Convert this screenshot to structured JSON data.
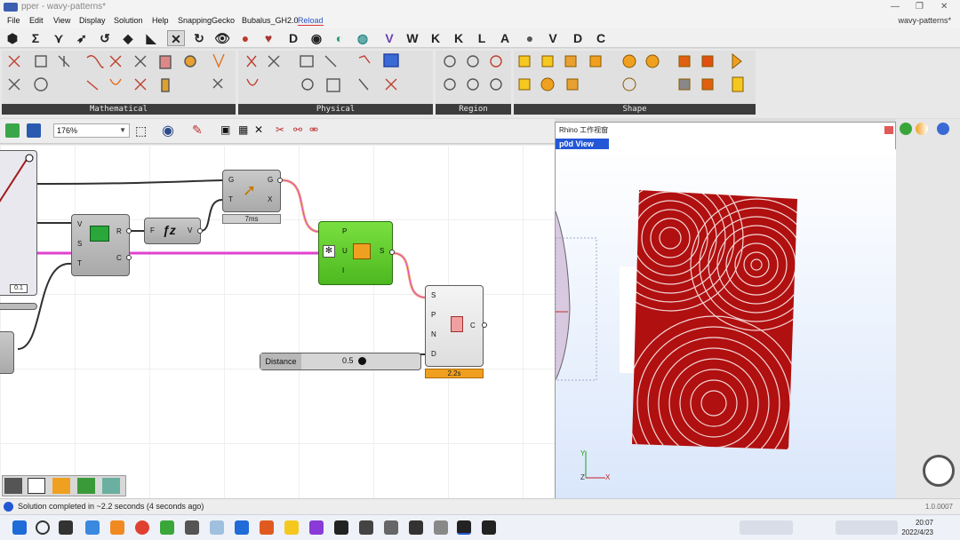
{
  "window": {
    "title": "pper - wavy-patterns*",
    "doc_name": "wavy-patterns*"
  },
  "menu": [
    "File",
    "Edit",
    "View",
    "Display",
    "Solution",
    "Help",
    "SnappingGecko",
    "Bubalus_GH2.0",
    "Reload"
  ],
  "category_tabs": [
    "W",
    "K",
    "K",
    "L",
    "A",
    "V",
    "D",
    "C"
  ],
  "ribbon_panels": [
    "Mathematical",
    "Physical",
    "Region",
    "Shape"
  ],
  "canvas": {
    "zoom": "176%",
    "components": {
      "gradient": {
        "inputs": [
          "G",
          "T"
        ],
        "outputs": [
          "G",
          "X"
        ],
        "timer": "7ms"
      },
      "graph": {
        "inputs": [
          "V",
          "S",
          "T"
        ],
        "outputs": [
          "R",
          "C"
        ]
      },
      "expression": {
        "input": "F",
        "output": "V"
      },
      "bool_union": {
        "inputs": [
          "P",
          "U",
          "I"
        ],
        "output": "S"
      },
      "offset": {
        "inputs": [
          "S",
          "P",
          "N",
          "D"
        ],
        "output": "C",
        "timer": "2.2s"
      },
      "slider": {
        "label": "Distance",
        "value": "0.5"
      },
      "readout": "0.1"
    }
  },
  "rhino": {
    "title": "Rhino 工作视窗",
    "viewport": "p0d View",
    "axis": {
      "x": "X",
      "y": "Y",
      "z": "Z"
    }
  },
  "status": {
    "message": "Solution completed in ~2.2 seconds (4 seconds ago)",
    "version": "1.0.0007"
  },
  "taskbar": {
    "time": "20:07",
    "date": "2022/4/23"
  },
  "colors": {
    "wire_pink": "#e040d0",
    "wire_orange": "#f0b070",
    "comp_green": "#5ccc2a",
    "pattern_red": "#b01010",
    "viewport_label": "#2357d6"
  }
}
